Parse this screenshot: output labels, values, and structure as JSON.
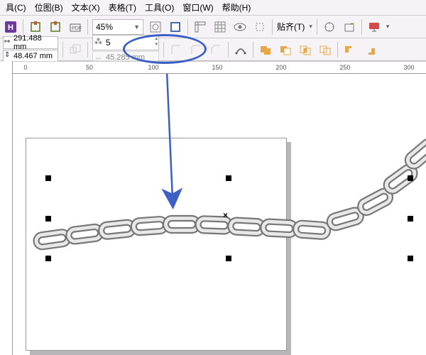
{
  "menu": {
    "items": [
      "具(C)",
      "位图(B)",
      "文本(X)",
      "表格(T)",
      "工具(O)",
      "窗口(W)",
      "帮助(H)"
    ]
  },
  "toolbar1": {
    "zoom": "45%",
    "paste_label": "贴齐(T)"
  },
  "toolbar2": {
    "x_value": "291.488 mm",
    "y_value": "48.467 mm",
    "copies_value": "5",
    "width_value": "45.285 mm"
  },
  "ruler": {
    "ticks": [
      "0",
      "50",
      "100",
      "150",
      "200",
      "250",
      "300"
    ]
  },
  "icons": {
    "logo": "H",
    "snap": "⌗",
    "eye": "👁",
    "align": "⊞"
  }
}
